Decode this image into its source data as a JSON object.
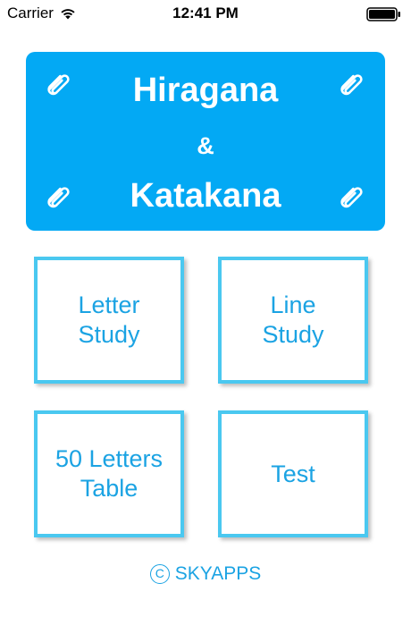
{
  "status_bar": {
    "carrier": "Carrier",
    "time": "12:41 PM",
    "wifi_icon": "wifi-icon",
    "battery_icon": "battery-full-icon"
  },
  "banner": {
    "title_line_1": "Hiragana",
    "ampersand": "&",
    "title_line_2": "Katakana",
    "background_color": "#03a9f4",
    "decoration_icon": "paperclip-icon"
  },
  "menu": {
    "tiles": [
      {
        "label": "Letter\nStudy"
      },
      {
        "label": "Line\nStudy"
      },
      {
        "label": "50 Letters\nTable"
      },
      {
        "label": "Test"
      }
    ],
    "border_color": "#4ac8f0",
    "text_color": "#1ba3e3"
  },
  "footer": {
    "copyright_symbol": "C",
    "brand": "SKYAPPS"
  }
}
